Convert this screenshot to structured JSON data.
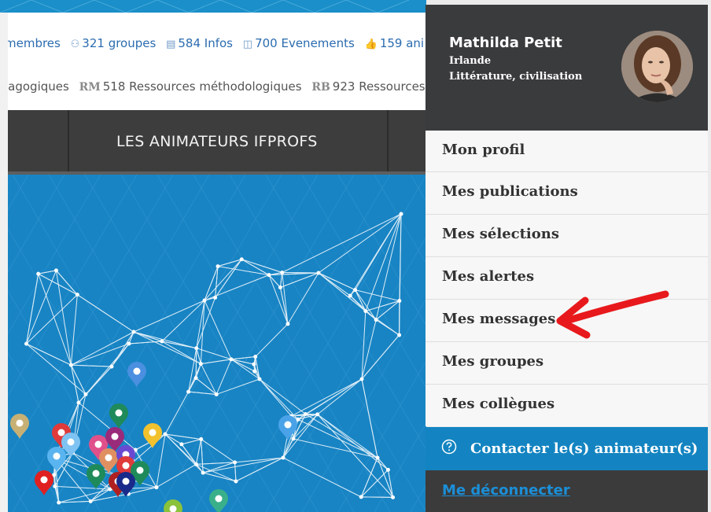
{
  "stats_row1": [
    {
      "icon": "members-icon",
      "text": "membres"
    },
    {
      "icon": "groups-icon",
      "text": "321 groupes"
    },
    {
      "icon": "news-icon",
      "text": "584 Infos"
    },
    {
      "icon": "events-icon",
      "text": "700 Evenements"
    },
    {
      "icon": "thumbs-up-icon",
      "text": "159 ani"
    }
  ],
  "stats_row2": [
    {
      "icon": "",
      "text": "lagogiques"
    },
    {
      "icon": "RM",
      "text": "518 Ressources méthodologiques"
    },
    {
      "icon": "RB",
      "text": "923 Ressources"
    }
  ],
  "nav": {
    "animateurs": "LES ANIMATEURS IFPROFS"
  },
  "user": {
    "name": "Mathilda Petit",
    "country": "Irlande",
    "subject": "Littérature, civilisation"
  },
  "menu": [
    "Mon profil",
    "Mes publications",
    "Mes sélections",
    "Mes alertes",
    "Mes messages",
    "Mes groupes",
    "Mes collègues"
  ],
  "contact": {
    "label": "Contacter le(s) animateur(s)"
  },
  "logout": {
    "label": "Me déconnecter"
  },
  "colors": {
    "brand_blue": "#1384c1",
    "header_dark": "#3a3b3d",
    "annotation_arrow": "#e8191c"
  }
}
